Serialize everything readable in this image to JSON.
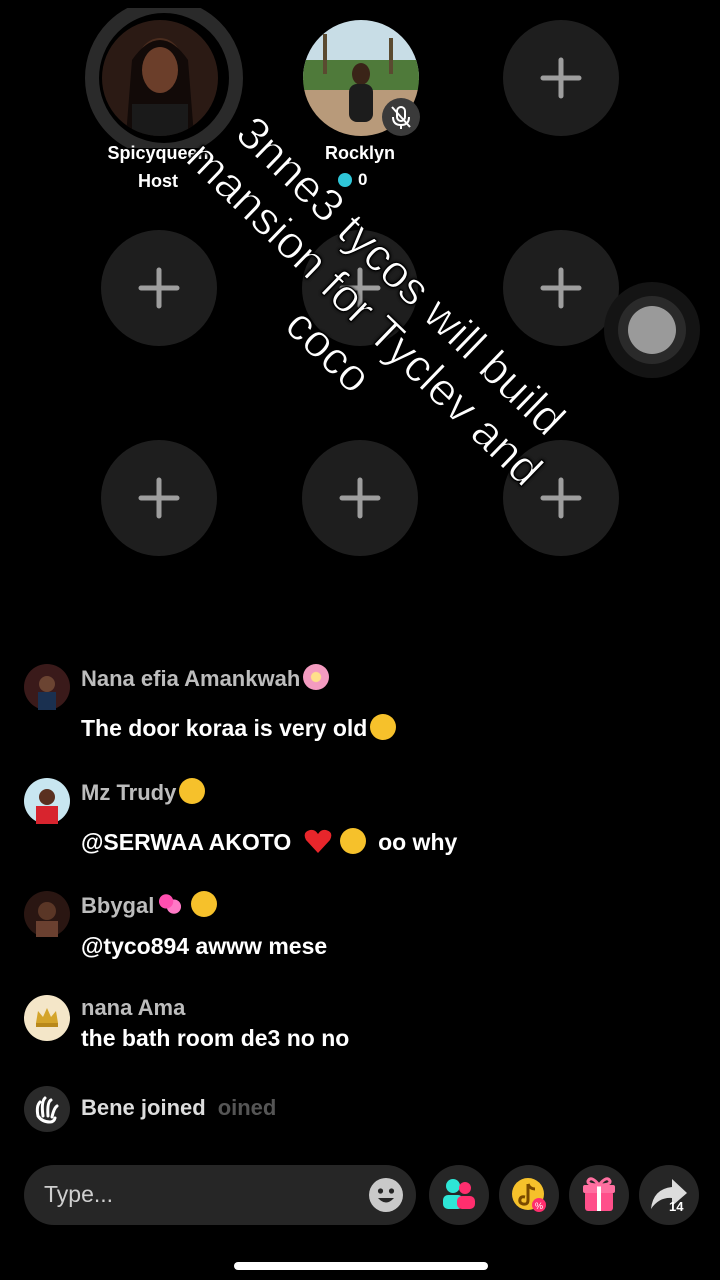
{
  "stage": {
    "host": {
      "name": "Spicyqueen",
      "role": "Host"
    },
    "guest": {
      "name": "Rocklyn",
      "count": "0"
    }
  },
  "overlay": {
    "caption": "3nne3 tycos will build mansion for Tyclev and coco"
  },
  "comments": [
    {
      "user": "Nana efia Amankwah",
      "user_emoji": "flower",
      "message": "The door koraa is very old",
      "message_emoji": "rofl"
    },
    {
      "user": "Mz Trudy",
      "user_emoji": "smiling-hearts",
      "message": "@SERWAA AKOTO",
      "message_emoji": "heart pleading",
      "message_suffix": "oo why"
    },
    {
      "user": "Bbygal",
      "user_emoji": "two-hearts weary",
      "message": "@tyco894 awww mese"
    },
    {
      "user": "nana Ama",
      "message": "the bath room de3 no no"
    }
  ],
  "join": {
    "text": "Bene joined",
    "ghost_text": "oined"
  },
  "input": {
    "placeholder": "Type..."
  },
  "toolbar": {
    "share_count": "14"
  },
  "colors": {
    "accent_teal": "#2ee6d6",
    "accent_pink": "#ff2e6e",
    "gold": "#f6c12b"
  }
}
